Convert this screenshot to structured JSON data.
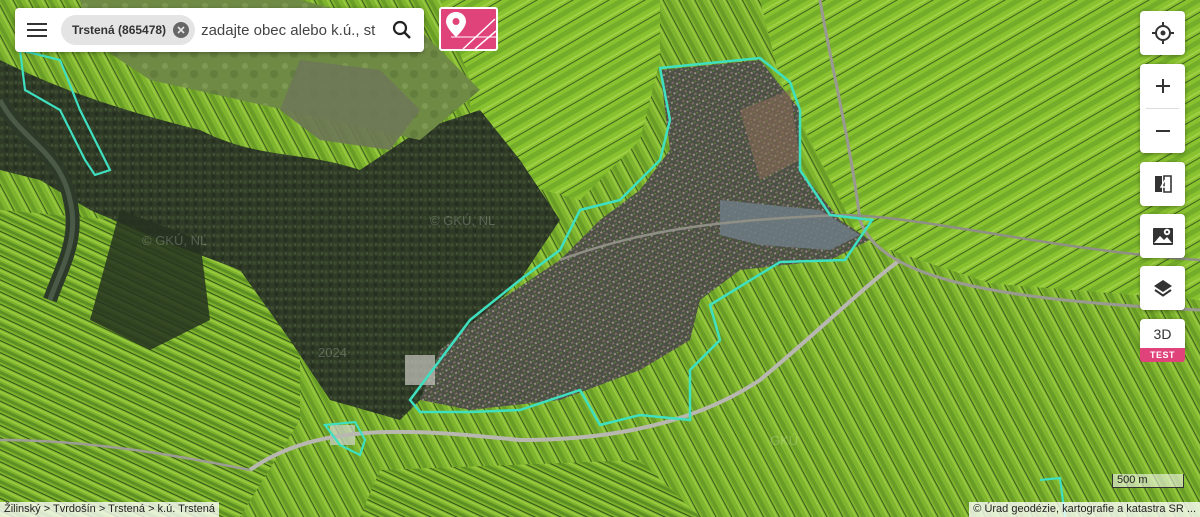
{
  "search": {
    "chip_label": "Trstená (865478)",
    "placeholder": "zadajte obec alebo k.ú., stlač"
  },
  "icons": {
    "menu": "hamburger-menu-icon",
    "chip_clear": "close-circle-icon",
    "search": "search-icon",
    "parcel": "map-pin-parcel-icon",
    "locate": "crosshair-location-icon",
    "zoom_in": "plus-icon",
    "zoom_out": "minus-icon",
    "compare": "split-compare-icon",
    "basemap": "map-photo-icon",
    "layers": "layers-icon"
  },
  "controls": {
    "zoom_in_label": "+",
    "zoom_out_label": "−",
    "btn_3d_label": "3D",
    "test_badge": "TEST"
  },
  "map": {
    "scale_label": "500 m",
    "breadcrumb": "Žilinský > Tvrdošín > Trstená > k.ú. Trstená",
    "attribution": "© Úrad geodézie, kartografie a katastra SR ...",
    "watermarks": [
      "© GKÚ, NL",
      "© GKÚ, NL",
      "2024",
      "GKÚ"
    ],
    "boundary_color": "#3ee0c0",
    "accent_color": "#e0427a"
  }
}
